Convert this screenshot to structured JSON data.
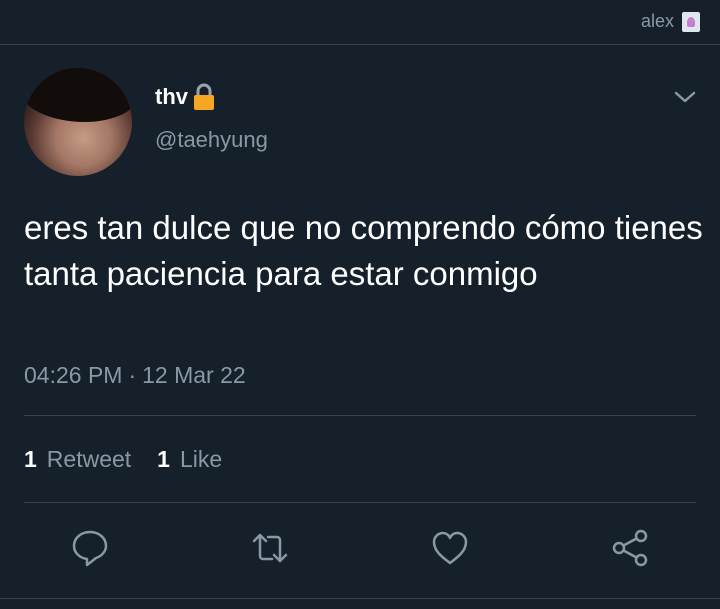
{
  "account": {
    "username": "alex"
  },
  "tweet": {
    "display_name": "thv",
    "handle": "@taehyung",
    "text": "eres tan dulce que no comprendo cómo tienes tanta paciencia para estar conmigo",
    "time": "04:26 PM",
    "separator": "·",
    "date": "12 Mar 22",
    "retweets": {
      "count": "1",
      "label": "Retweet"
    },
    "likes": {
      "count": "1",
      "label": "Like"
    }
  },
  "colors": {
    "background": "#15202b",
    "secondary_text": "#8899a6",
    "divider": "#38444d",
    "lock": "#f5a623"
  },
  "icons": [
    "lock-icon",
    "chevron-down-icon",
    "reply-icon",
    "retweet-icon",
    "like-icon",
    "share-icon"
  ]
}
